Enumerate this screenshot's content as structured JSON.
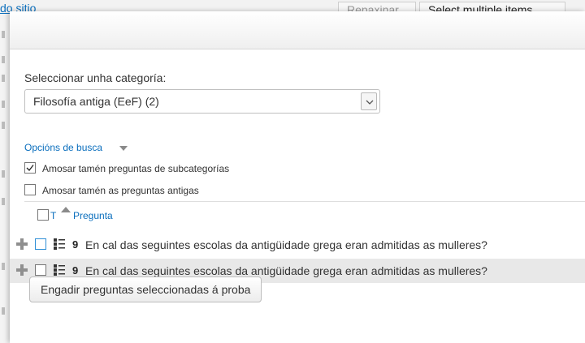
{
  "background": {
    "link_text": "do sitio",
    "buttons": [
      "Repaxinar",
      "Select multiple items"
    ]
  },
  "category": {
    "label": "Seleccionar unha categoría:",
    "selected": "Filosofía antiga (EeF) (2)"
  },
  "search_options": {
    "toggle_label": "Opcións de busca",
    "options": [
      {
        "label": "Amosar tamén preguntas de subcategorías",
        "checked": true
      },
      {
        "label": "Amosar tamén as preguntas antigas",
        "checked": false
      }
    ]
  },
  "table": {
    "col_type": "T",
    "col_question": "Pregunta",
    "rows": [
      {
        "grade": "9",
        "text": "En cal das seguintes escolas da antigüidade grega eran admitidas as mulleres?",
        "checked": false
      },
      {
        "grade": "9",
        "text": "En cal das seguintes escolas da antigüidade grega eran admitidas as mulleres?",
        "checked": false
      }
    ]
  },
  "add_button_label": "Engadir preguntas seleccionadas á proba",
  "colors": {
    "link": "#0a6ebd",
    "row_alt": "#e8e8e8",
    "focus_border": "#2f8fd6"
  },
  "icons": [
    "plus-icon",
    "multichoice-icon",
    "checkmark-icon",
    "sort-asc-icon",
    "chevron-down-icon"
  ]
}
